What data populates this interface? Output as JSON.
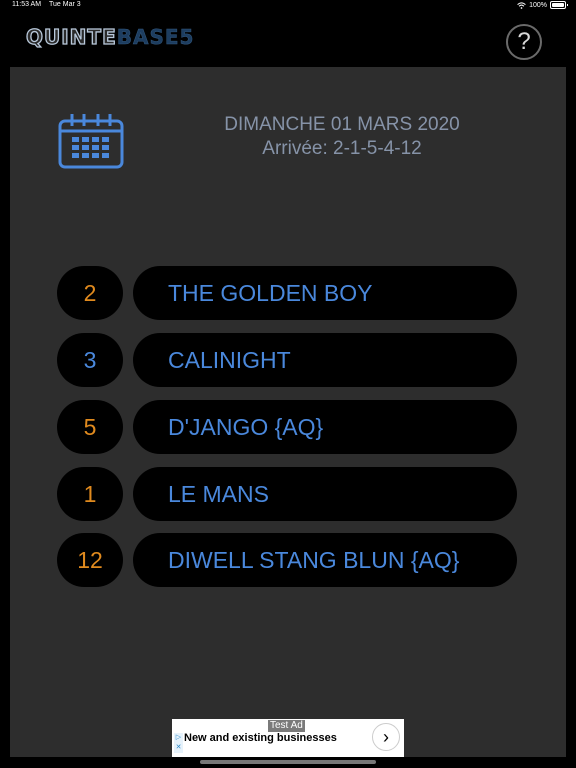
{
  "status_bar": {
    "time": "11:53 AM",
    "date": "Tue Mar 3",
    "battery": "100%"
  },
  "header": {
    "logo_part1": "QUINTE",
    "logo_part2": "BASE5",
    "help_label": "?"
  },
  "race": {
    "date": "DIMANCHE 01 MARS 2020",
    "arrival": "Arrivée: 2-1-5-4-12"
  },
  "results": [
    {
      "number": "2",
      "name": "THE GOLDEN BOY",
      "color": "#e08a1e"
    },
    {
      "number": "3",
      "name": "CALINIGHT",
      "color": "#4a88dc"
    },
    {
      "number": "5",
      "name": "D'JANGO {AQ}",
      "color": "#e08a1e"
    },
    {
      "number": "1",
      "name": "LE MANS",
      "color": "#e08a1e"
    },
    {
      "number": "12",
      "name": "DIWELL STANG BLUN {AQ}",
      "color": "#e08a1e"
    }
  ],
  "ad": {
    "label": "Test Ad",
    "text": "New and existing businesses",
    "cta": "›"
  },
  "colors": {
    "accent_blue": "#4a88dc",
    "accent_orange": "#e08a1e",
    "panel": "#2d2d2d"
  }
}
